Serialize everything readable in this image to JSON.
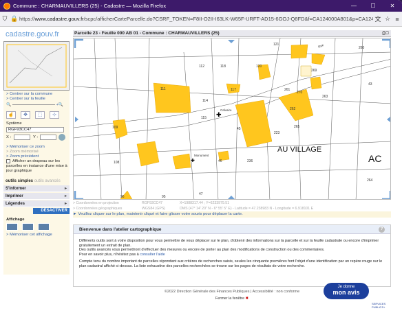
{
  "window": {
    "title": "Commune : CHARMAUVILLERS (25) - Cadastre — Mozilla Firefox",
    "min": "—",
    "max": "☐",
    "close": "✕"
  },
  "urlbar": {
    "scheme": "https://",
    "domain": "www.cadastre.gouv.fr",
    "path": "/scpc/afficherCarteParcelle.do?CSRF_TOKEN=F8II-O2II-I63LK-W65F-URFT-AD15-6GOJ-Q8FD&f=CA124000A801&p=CA12400C"
  },
  "site": {
    "logo": "cadastre.gouv.fr"
  },
  "left": {
    "links": [
      "> Centrer sur la commune",
      "> Centrer sur la feuille"
    ],
    "systeme_label": "Système",
    "systeme_value": "RGF93CC47",
    "x_label": "X :",
    "y_label": "Y :",
    "mem_links": [
      "> Mémoriser ce zoom",
      "> Zoom mémorisé",
      "> Zoom précédent"
    ],
    "checkbox_text": "Afficher un drapeau sur les parcelles en instance d'une mise à jour graphique",
    "tools_tab1": "outils simples",
    "tools_tab2": "outils avancés",
    "s_informer": "S'informer",
    "imprimer": "Imprimer",
    "legendes": "Légendes",
    "desactiver": "DÉSACTIVER",
    "affichage": "Affichage",
    "memo_affichage": "> Mémoriser cet affichage"
  },
  "map": {
    "header": "Parcelle 23 - Feuille 000 AB 01 - Commune : CHARMAUVILLERS (25)",
    "label_village": "AU VILLAGE",
    "label_ac": "AC",
    "label_calvaire": "Calvaire",
    "label_monument": "Monument",
    "label_rue": "Rue",
    "parcels": [
      "121",
      "260",
      "112",
      "118",
      "120",
      "269",
      "111",
      "117",
      "261",
      "270",
      "43",
      "114",
      "263",
      "115",
      "262",
      "109",
      "45",
      "223",
      "265",
      "108",
      "46",
      "236",
      "264",
      "96",
      "95",
      "47"
    ]
  },
  "coords": {
    "proj_label": "> Coordonnées en projection",
    "proj_sys": "RGF93CC47",
    "proj_val": "X=1988317.44 ; Y=6233979.51",
    "geo_label": "> Coordonnées géographiques",
    "geo_sys": "WGS84 (GPS)",
    "geo_val": "DMS (47° 14' 20\" N - 6° 55' 5\" E) - Latitude = 47.238983 N - Longitude = 6.918101 E"
  },
  "warn": "► Veuillez cliquer sur le plan, maintenir cliqué et faire glisser votre souris pour déplacer la carte.",
  "help": {
    "title": "Bienvenue dans l'atelier cartographique",
    "p1": "Différents outils sont à votre disposition pour vous permettre de vous déplacer sur le plan, d'obtenir des informations sur la parcelle et sur la feuille cadastrale ou encore d'imprimer gratuitement un extrait de plan.",
    "p2": "Des outils avancés vous permettront d'effectuer des mesures ou encore de porter au plan des modifications de construction ou des commentaires.",
    "p3a": "Pour en savoir plus, n'hésitez pas à ",
    "p3link": "consulter l'aide",
    "p4": "Compte tenu du nombre important de parcelles répondant aux critères de recherches saisis, seules les cinquante premières font l'objet d'une identification par un repère rouge sur le plan cadastral affiché ci-dessus. La liste exhaustive des parcelles recherchées se trouve sur les pages de résultats de votre recherche."
  },
  "footer": {
    "copyright": "©2022 Direction Générale des Finances Publiques",
    "sep": "|",
    "access": "Accessibilité : non conforme",
    "close": "Fermer la fenêtre"
  },
  "donne": {
    "line1": "Je donne",
    "line2": "mon avis",
    "sub": "SERVICES PUBLICS+"
  },
  "colors": {
    "parcel": "#ffc61e",
    "accent": "#2e6fc0",
    "corner": "#6fa0d4"
  }
}
